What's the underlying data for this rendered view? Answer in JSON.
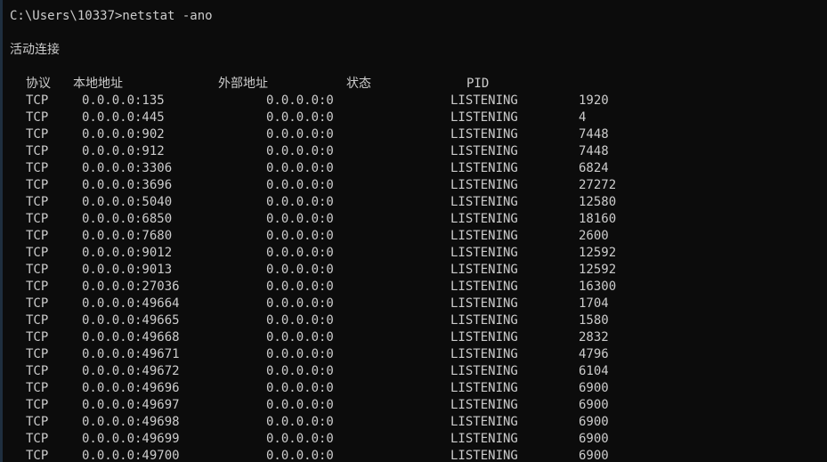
{
  "window": {
    "prompt": "C:\\Users\\10337>netstat -ano",
    "section_title": "活动连接"
  },
  "headers": {
    "proto": "协议",
    "local": "本地地址",
    "foreign": "外部地址",
    "state": "状态",
    "pid": "PID"
  },
  "rows": [
    {
      "proto": "TCP",
      "local": "0.0.0.0:135",
      "foreign": "0.0.0.0:0",
      "state": "LISTENING",
      "pid": "1920"
    },
    {
      "proto": "TCP",
      "local": "0.0.0.0:445",
      "foreign": "0.0.0.0:0",
      "state": "LISTENING",
      "pid": "4"
    },
    {
      "proto": "TCP",
      "local": "0.0.0.0:902",
      "foreign": "0.0.0.0:0",
      "state": "LISTENING",
      "pid": "7448"
    },
    {
      "proto": "TCP",
      "local": "0.0.0.0:912",
      "foreign": "0.0.0.0:0",
      "state": "LISTENING",
      "pid": "7448"
    },
    {
      "proto": "TCP",
      "local": "0.0.0.0:3306",
      "foreign": "0.0.0.0:0",
      "state": "LISTENING",
      "pid": "6824"
    },
    {
      "proto": "TCP",
      "local": "0.0.0.0:3696",
      "foreign": "0.0.0.0:0",
      "state": "LISTENING",
      "pid": "27272"
    },
    {
      "proto": "TCP",
      "local": "0.0.0.0:5040",
      "foreign": "0.0.0.0:0",
      "state": "LISTENING",
      "pid": "12580"
    },
    {
      "proto": "TCP",
      "local": "0.0.0.0:6850",
      "foreign": "0.0.0.0:0",
      "state": "LISTENING",
      "pid": "18160"
    },
    {
      "proto": "TCP",
      "local": "0.0.0.0:7680",
      "foreign": "0.0.0.0:0",
      "state": "LISTENING",
      "pid": "2600"
    },
    {
      "proto": "TCP",
      "local": "0.0.0.0:9012",
      "foreign": "0.0.0.0:0",
      "state": "LISTENING",
      "pid": "12592"
    },
    {
      "proto": "TCP",
      "local": "0.0.0.0:9013",
      "foreign": "0.0.0.0:0",
      "state": "LISTENING",
      "pid": "12592"
    },
    {
      "proto": "TCP",
      "local": "0.0.0.0:27036",
      "foreign": "0.0.0.0:0",
      "state": "LISTENING",
      "pid": "16300"
    },
    {
      "proto": "TCP",
      "local": "0.0.0.0:49664",
      "foreign": "0.0.0.0:0",
      "state": "LISTENING",
      "pid": "1704"
    },
    {
      "proto": "TCP",
      "local": "0.0.0.0:49665",
      "foreign": "0.0.0.0:0",
      "state": "LISTENING",
      "pid": "1580"
    },
    {
      "proto": "TCP",
      "local": "0.0.0.0:49668",
      "foreign": "0.0.0.0:0",
      "state": "LISTENING",
      "pid": "2832"
    },
    {
      "proto": "TCP",
      "local": "0.0.0.0:49671",
      "foreign": "0.0.0.0:0",
      "state": "LISTENING",
      "pid": "4796"
    },
    {
      "proto": "TCP",
      "local": "0.0.0.0:49672",
      "foreign": "0.0.0.0:0",
      "state": "LISTENING",
      "pid": "6104"
    },
    {
      "proto": "TCP",
      "local": "0.0.0.0:49696",
      "foreign": "0.0.0.0:0",
      "state": "LISTENING",
      "pid": "6900"
    },
    {
      "proto": "TCP",
      "local": "0.0.0.0:49697",
      "foreign": "0.0.0.0:0",
      "state": "LISTENING",
      "pid": "6900"
    },
    {
      "proto": "TCP",
      "local": "0.0.0.0:49698",
      "foreign": "0.0.0.0:0",
      "state": "LISTENING",
      "pid": "6900"
    },
    {
      "proto": "TCP",
      "local": "0.0.0.0:49699",
      "foreign": "0.0.0.0:0",
      "state": "LISTENING",
      "pid": "6900"
    },
    {
      "proto": "TCP",
      "local": "0.0.0.0:49700",
      "foreign": "0.0.0.0:0",
      "state": "LISTENING",
      "pid": "6900"
    }
  ],
  "colors": {
    "background": "#0c0c0c",
    "foreground": "#cccccc"
  }
}
